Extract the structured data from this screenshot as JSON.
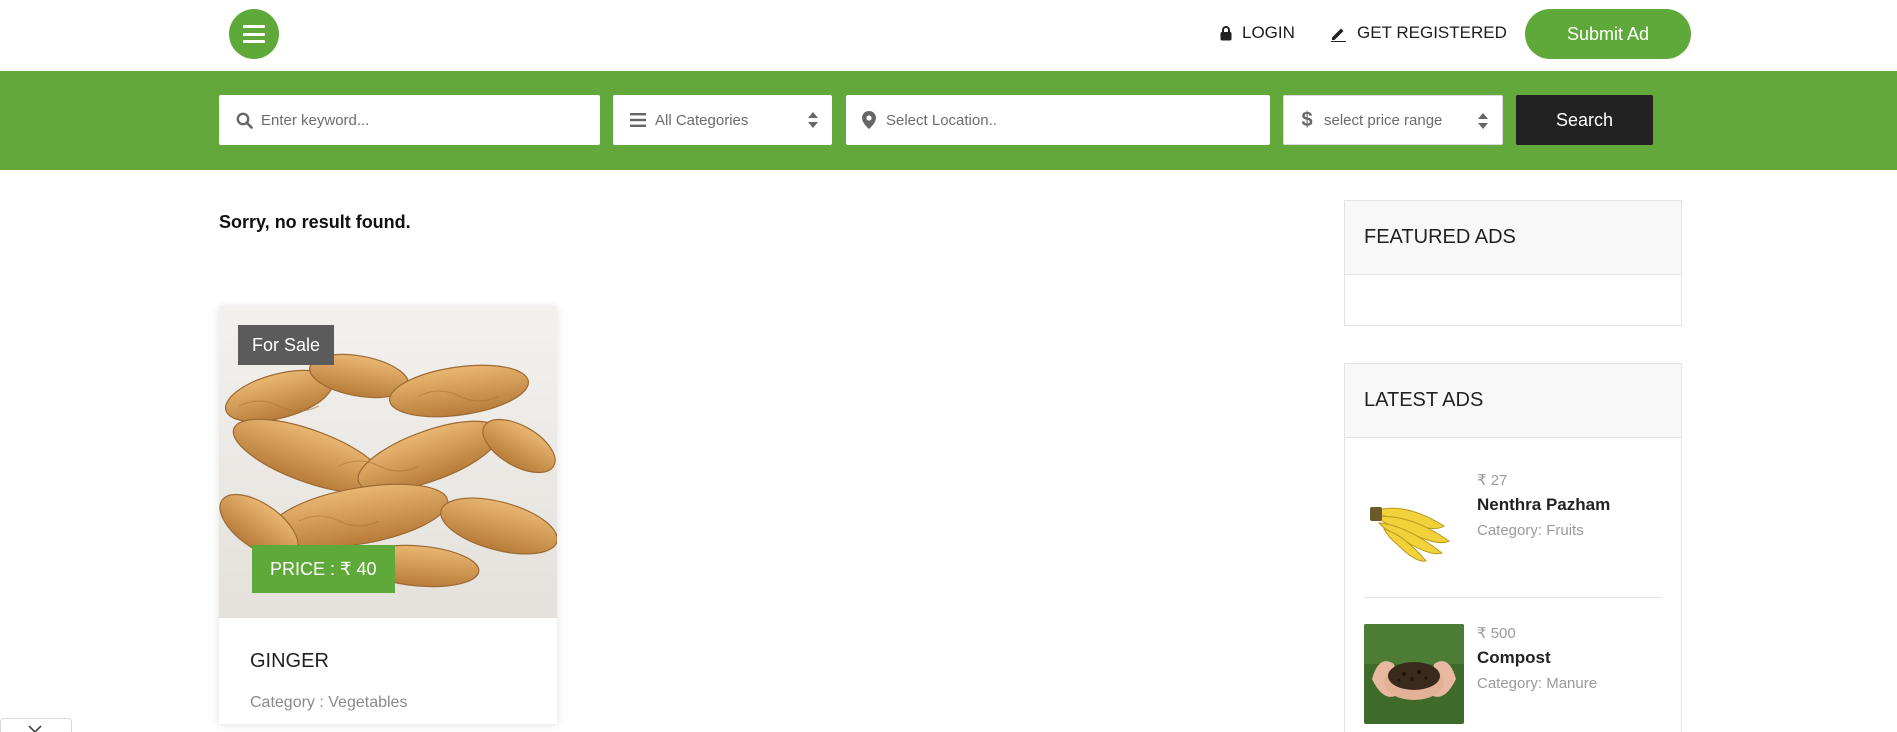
{
  "header": {
    "login_label": "LOGIN",
    "register_label": "GET REGISTERED",
    "submit_label": "Submit Ad"
  },
  "search": {
    "keyword_placeholder": "Enter keyword...",
    "category_selected": "All Categories",
    "location_placeholder": "Select Location..",
    "price_selected": "select price range",
    "button_label": "Search"
  },
  "main": {
    "no_result": "Sorry, no result found.",
    "card": {
      "badge": "For Sale",
      "price": "PRICE : ₹ 40",
      "title": "GINGER",
      "category": "Category : Vegetables"
    }
  },
  "sidebar": {
    "featured_title": "FEATURED ADS",
    "latest_title": "LATEST ADS",
    "latest_items": [
      {
        "price": "₹ 27",
        "name": "Nenthra Pazham",
        "category": "Category: Fruits"
      },
      {
        "price": "₹ 500",
        "name": "Compost",
        "category": "Category: Manure"
      }
    ]
  },
  "colors": {
    "brand_green": "#5fa83a",
    "dark": "#222222"
  },
  "icons": [
    "menu-icon",
    "lock-icon",
    "pencil-icon",
    "search-icon",
    "list-icon",
    "map-pin-icon",
    "dollar-icon",
    "sort-arrows-icon",
    "close-icon"
  ]
}
